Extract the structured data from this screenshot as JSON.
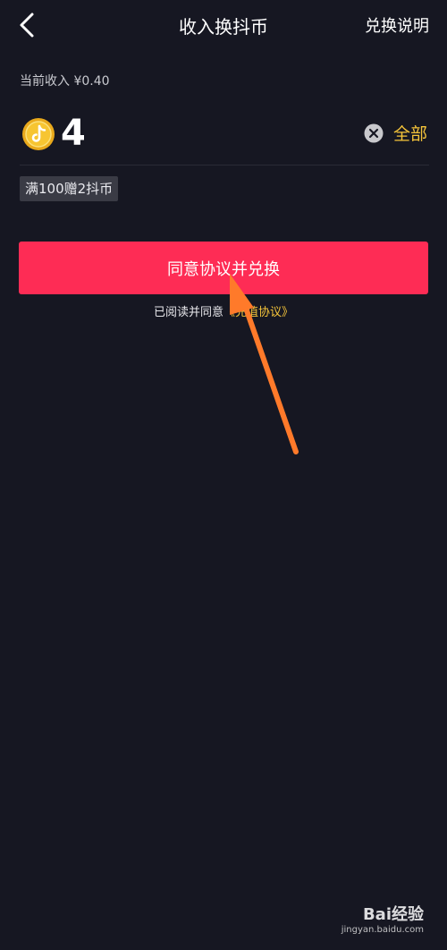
{
  "header": {
    "title": "收入换抖币",
    "help_label": "兑换说明"
  },
  "income": {
    "label": "当前收入 ¥0.40"
  },
  "exchange": {
    "amount": "4",
    "all_label": "全部",
    "promo": "满100赠2抖币",
    "button_label": "同意协议并兑换"
  },
  "agreement": {
    "prefix": "已阅读并同意",
    "link": "《充值协议》"
  },
  "watermark": {
    "logo": "Bai经验",
    "url": "jingyan.baidu.com"
  },
  "colors": {
    "background": "#161722",
    "accent": "#fe2c55",
    "gold": "#f5c43a",
    "annotation_arrow": "#ff7a2a"
  }
}
